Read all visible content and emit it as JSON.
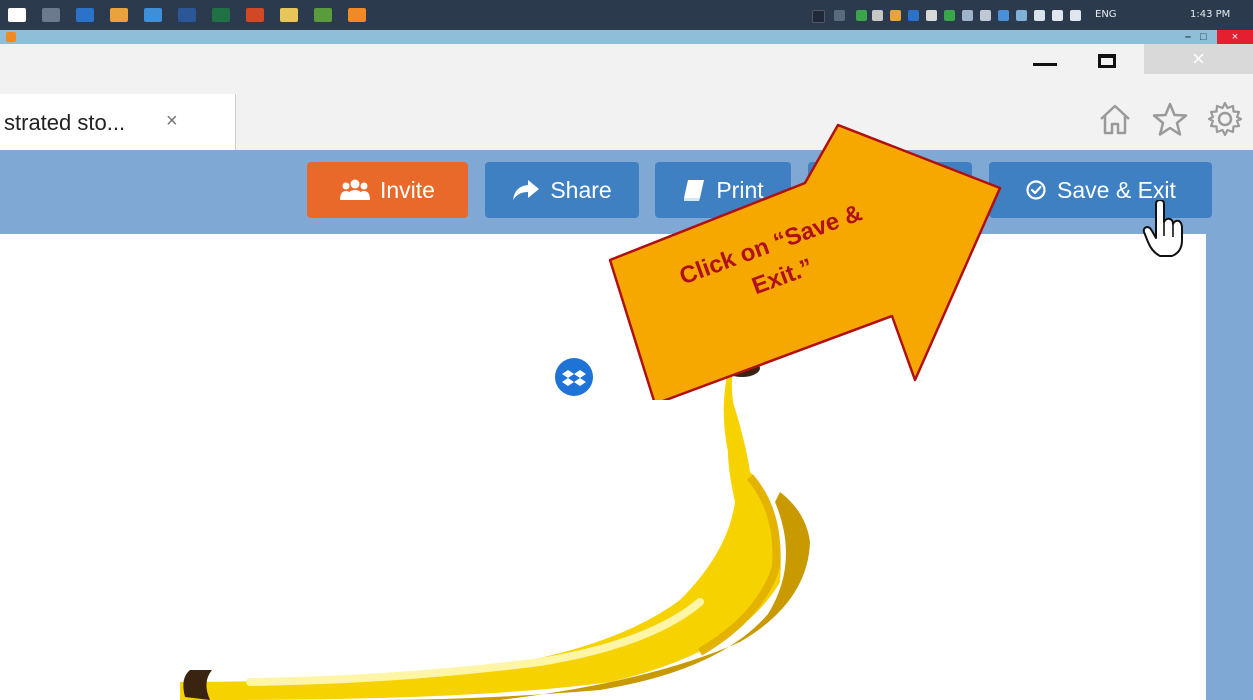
{
  "taskbar": {
    "apps": [
      {
        "name": "start",
        "color": "#ffffff"
      },
      {
        "name": "task-view",
        "color": "#6b7a8c"
      },
      {
        "name": "outlook",
        "color": "#2b72c9"
      },
      {
        "name": "chrome",
        "color": "#e8a33c"
      },
      {
        "name": "ie",
        "color": "#3e8fd8"
      },
      {
        "name": "word",
        "color": "#2b5797"
      },
      {
        "name": "excel",
        "color": "#207245"
      },
      {
        "name": "powerpoint",
        "color": "#d24726"
      },
      {
        "name": "explorer",
        "color": "#e8c55a"
      },
      {
        "name": "camtasia",
        "color": "#5a9c3c"
      },
      {
        "name": "recorder",
        "color": "#f08a24"
      }
    ],
    "language": "ENG",
    "time": "1:43 PM"
  },
  "title_strip": {
    "min_label": "–",
    "restore_label": "□",
    "close_label": "×"
  },
  "browser": {
    "tab_title": "strated sto...",
    "tab_close": "×",
    "close_label": "×"
  },
  "toolbar": {
    "invite_label": "Invite",
    "share_label": "Share",
    "print_label": "Print",
    "present_label": "",
    "save_label": "Save & Exit"
  },
  "callout": {
    "line1": "Click on “Save &",
    "line2": "Exit.”"
  },
  "colors": {
    "toolbar_bg": "#7fa9d4",
    "invite": "#e9692a",
    "button_blue": "#3f80c3",
    "arrow_fill": "#f7a800",
    "callout_text": "#b0101a"
  }
}
